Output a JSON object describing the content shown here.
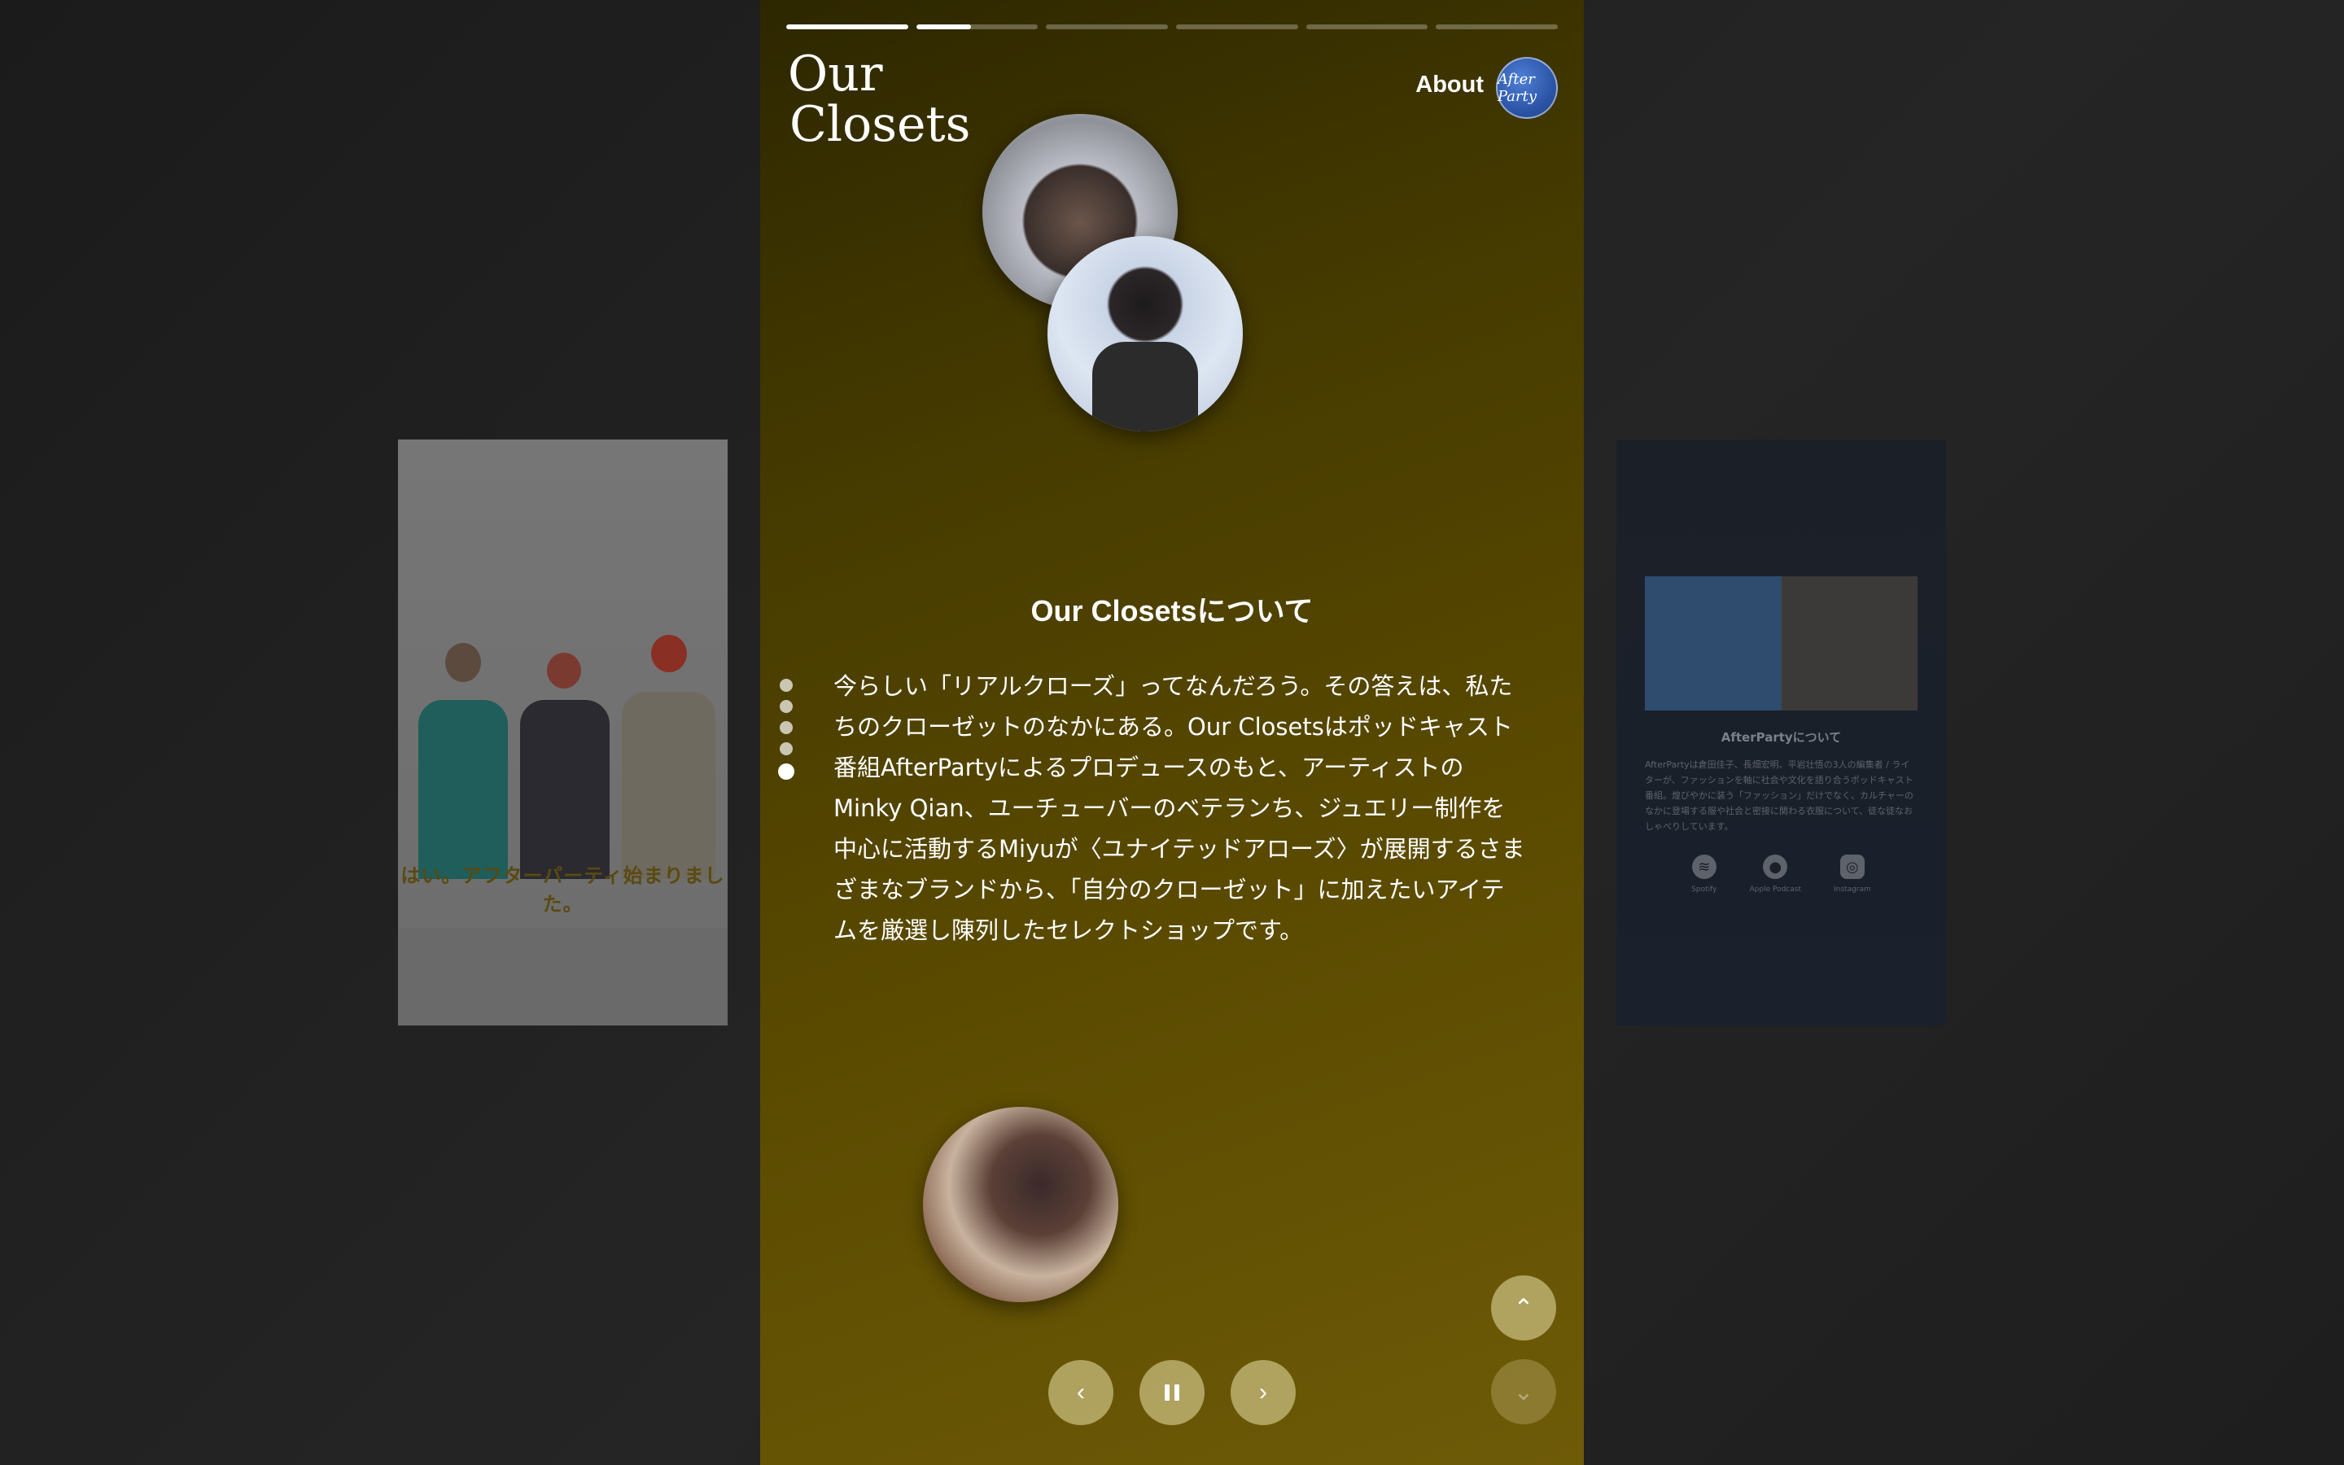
{
  "left_card": {
    "caption": "はい。アフターパーティ始まりました。"
  },
  "right_card": {
    "title": "AfterPartyについて",
    "description": "AfterPartyは倉田佳子、長畑宏明、平岩壮悟の3人の編集者 / ライターが、ファッションを軸に社会や文化を語り合うポッドキャスト番組。煌びやかに装う「ファッション」だけでなく、カルチャーのなかに登場する服や社会と密接に関わる衣服について、徒な徒なおしゃべりしています。",
    "links": [
      {
        "label": "Spotify",
        "icon": "spotify-icon"
      },
      {
        "label": "Apple Podcast",
        "icon": "apple-icon"
      },
      {
        "label": "Instagram",
        "icon": "instagram-icon"
      }
    ]
  },
  "story": {
    "progress": [
      1,
      0.45,
      0,
      0,
      0,
      0
    ],
    "logo_line1": "Our",
    "logo_line2": "Closets",
    "about_label": "About",
    "avatar_text": "After Party",
    "title": "Our Closetsについて",
    "body": "今らしい「リアルクローズ」ってなんだろう。その答えは、私たちのクローゼットのなかにある。Our Closetsはポッドキャスト番組AfterPartyによるプロデュースのもと、アーティストのMinky Qian、ユーチューバーのベテランち、ジュエリー制作を中心に活動するMiyuが〈ユナイテッドアローズ〉が展開するさまざまなブランドから、「自分のクローゼット」に加えたいアイテムを厳選し陳列したセレクトショップです。",
    "dots": 5,
    "active_dot": 4
  },
  "colors": {
    "panel_accent": "#5a4a00",
    "control_bg": "#ebe1aa"
  }
}
